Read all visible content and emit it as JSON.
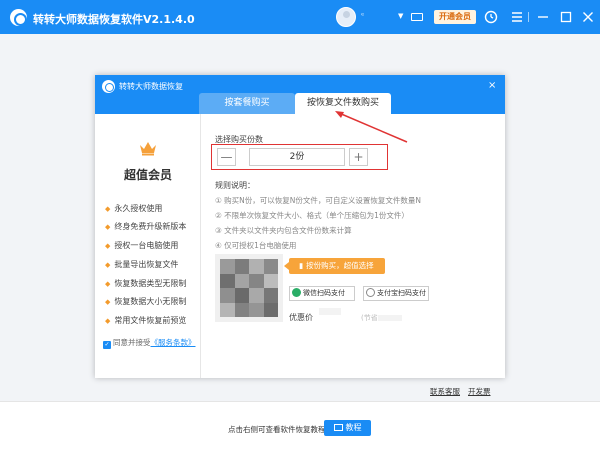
{
  "app": {
    "title": "转转大师数据恢复软件V2.1.4.0",
    "vip_button": "开通会员",
    "user_name": "ᵉ",
    "user_caret": "▼",
    "window_controls": [
      "monitor-icon",
      "refresh-icon",
      "menu-icon",
      "minimize-icon",
      "maximize-icon",
      "close-icon"
    ]
  },
  "modal": {
    "title": "转转大师数据恢复",
    "close": "×",
    "tabs": [
      {
        "label": "按套餐购买",
        "active": false
      },
      {
        "label": "按恢复文件数购买",
        "active": true
      }
    ],
    "sidebar": {
      "vip_title": "超值会员",
      "benefits": [
        "永久授权使用",
        "终身免费升级新版本",
        "授权一台电脑使用",
        "批量导出恢复文件",
        "恢复数据类型无限制",
        "恢复数据大小无限制",
        "常用文件恢复前预览"
      ],
      "agree_text": "同意并接受",
      "agree_link": "《服务条款》"
    },
    "purchase": {
      "quantity_label": "选择购买份数",
      "minus": "—",
      "quantity_value": "2份",
      "plus": "+",
      "rules_title": "规则说明：",
      "rules": [
        "① 购买N份，可以恢复N份文件，可自定义设置恢复文件数量N",
        "② 不限单次恢复文件大小、格式（单个压缩包为1份文件）",
        "③ 文件夹以文件夹内包含文件份数来计算",
        "④ 仅可授权1台电脑使用"
      ],
      "price_tag": "按份购买，超值选择",
      "pay_wechat": "微信扫码支付",
      "pay_alipay": "支付宝扫码支付",
      "discount_label": "优惠价",
      "discount_note": "(节省"
    },
    "links": {
      "contact": "联系客服",
      "invoice": "开发票"
    }
  },
  "footer": {
    "hint": "点击右侧可查看软件恢复教程",
    "tutorial_button": "教程"
  },
  "colors": {
    "brand_blue": "#1a8cf5",
    "accent_orange": "#f7a43a",
    "highlight_red": "#e03434"
  }
}
